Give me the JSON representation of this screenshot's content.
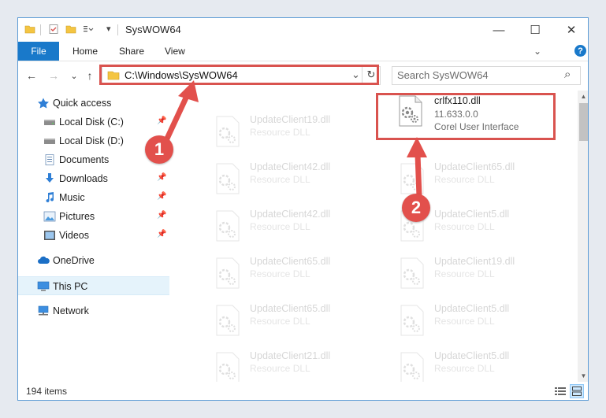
{
  "window": {
    "title": "SysWOW64",
    "minimize_glyph": "—",
    "maximize_glyph": "☐",
    "close_glyph": "✕",
    "help_glyph": "?"
  },
  "ribbon": {
    "file_tab": "File",
    "tabs": [
      "Home",
      "Share",
      "View"
    ]
  },
  "navigation": {
    "back_glyph": "←",
    "forward_glyph": "→",
    "recent_glyph": "⌄",
    "up_glyph": "↑"
  },
  "address": {
    "path": "C:\\Windows\\SysWOW64",
    "dropdown_glyph": "⌄",
    "refresh_glyph": "↻"
  },
  "search": {
    "placeholder": "Search SysWOW64",
    "icon_glyph": "⌕"
  },
  "sidebar": {
    "items": [
      {
        "label": "Quick access",
        "icon": "star-icon",
        "pinned": false,
        "indent": false
      },
      {
        "label": "Local Disk (C:)",
        "icon": "drive-icon",
        "pinned": true,
        "indent": true
      },
      {
        "label": "Local Disk (D:)",
        "icon": "drive-icon",
        "pinned": false,
        "indent": true
      },
      {
        "label": "Documents",
        "icon": "documents-icon",
        "pinned": false,
        "indent": true
      },
      {
        "label": "Downloads",
        "icon": "downloads-icon",
        "pinned": true,
        "indent": true
      },
      {
        "label": "Music",
        "icon": "music-icon",
        "pinned": true,
        "indent": true
      },
      {
        "label": "Pictures",
        "icon": "pictures-icon",
        "pinned": true,
        "indent": true
      },
      {
        "label": "Videos",
        "icon": "videos-icon",
        "pinned": true,
        "indent": true
      },
      {
        "label": "OneDrive",
        "icon": "cloud-icon",
        "pinned": false,
        "indent": false
      },
      {
        "label": "This PC",
        "icon": "computer-icon",
        "pinned": false,
        "indent": false,
        "selected": true
      },
      {
        "label": "Network",
        "icon": "network-icon",
        "pinned": false,
        "indent": false
      }
    ]
  },
  "files": {
    "highlighted": {
      "name": "crlfx110.dll",
      "version": "11.633.0.0",
      "description": "Corel User Interface"
    },
    "column1": [
      {
        "name": "UpdateClient19.dll",
        "type": "Resource DLL"
      },
      {
        "name": "UpdateClient42.dll",
        "type": "Resource DLL"
      },
      {
        "name": "UpdateClient42.dll",
        "type": "Resource DLL"
      },
      {
        "name": "UpdateClient65.dll",
        "type": "Resource DLL"
      },
      {
        "name": "UpdateClient65.dll",
        "type": "Resource DLL"
      },
      {
        "name": "UpdateClient21.dll",
        "type": "Resource DLL"
      }
    ],
    "column2": [
      {
        "name": "UpdateClient65.dll",
        "type": "Resource DLL"
      },
      {
        "name": "UpdateClient5.dll",
        "type": "Resource DLL"
      },
      {
        "name": "UpdateClient19.dll",
        "type": "Resource DLL"
      },
      {
        "name": "UpdateClient5.dll",
        "type": "Resource DLL"
      },
      {
        "name": "UpdateClient5.dll",
        "type": "Resource DLL"
      }
    ]
  },
  "status": {
    "item_count": "194 items"
  },
  "annotations": {
    "step1": "1",
    "step2": "2",
    "color": "#d9534f"
  },
  "colors": {
    "accent": "#1979ca",
    "folder": "#f4c542",
    "selection": "#e5f3fb"
  }
}
